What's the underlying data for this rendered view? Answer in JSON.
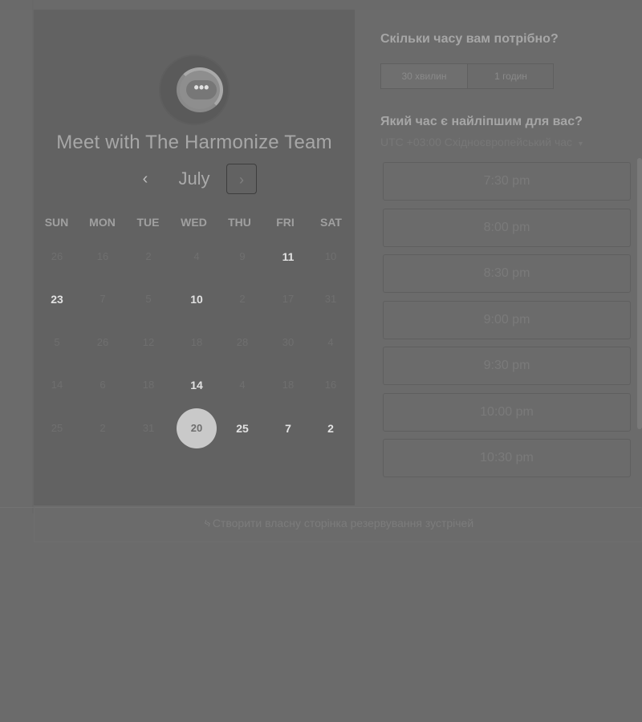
{
  "booking": {
    "team_name": "Meet with The Harmonize Team",
    "logo_icon": "chat-bubble-icon",
    "month": "July",
    "prev_icon": "‹",
    "next_icon": "›",
    "weekdays": [
      "SUN",
      "MON",
      "TUE",
      "WED",
      "THU",
      "FRI",
      "SAT"
    ],
    "weeks": [
      [
        "26",
        "16",
        "2",
        "4",
        "9",
        "11",
        "10"
      ],
      [
        "23",
        "7",
        "5",
        "10",
        "2",
        "17",
        "31"
      ],
      [
        "5",
        "26",
        "12",
        "18",
        "28",
        "30",
        "4"
      ],
      [
        "14",
        "6",
        "18",
        "14",
        "4",
        "18",
        "16"
      ],
      [
        "25",
        "2",
        "31",
        "20",
        "25",
        "7",
        "2"
      ]
    ],
    "available_days": [
      "11",
      "23",
      "10",
      "14",
      "25",
      "7",
      "2"
    ],
    "selected_day": "20"
  },
  "duration": {
    "question": "Скільки часу вам потрібно?",
    "options": [
      "30 хвилин",
      "1 годин"
    ],
    "selected": "30 хвилин"
  },
  "time": {
    "question": "Який час є найліпшим для вас?",
    "timezone": "UTC +03:00 Східноєвропейський час",
    "caret_icon": "caret-down-icon",
    "slots": [
      "7:30 pm",
      "8:00 pm",
      "8:30 pm",
      "9:00 pm",
      "9:30 pm",
      "10:00 pm",
      "10:30 pm"
    ]
  },
  "footer": {
    "link_text": "Створити власну сторінка резервування зустрічей",
    "icon": "sprocket-icon"
  }
}
